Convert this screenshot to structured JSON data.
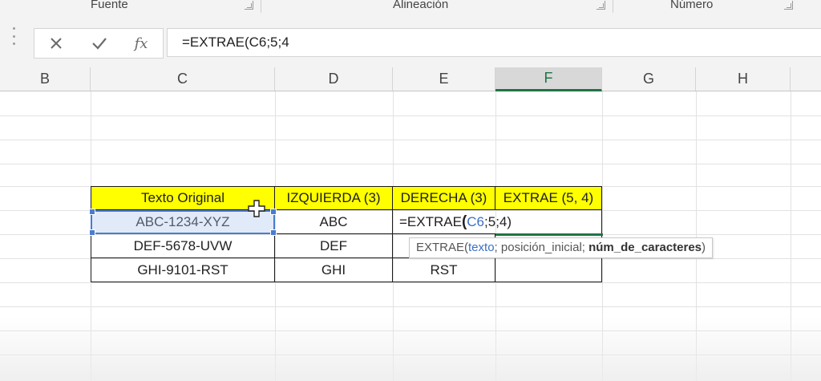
{
  "ribbon": {
    "groups": [
      {
        "label": "Fuente"
      },
      {
        "label": "Alineación"
      },
      {
        "label": "Número"
      }
    ]
  },
  "formula_bar": {
    "cancel_icon": "close-icon",
    "enter_icon": "check-icon",
    "fx_label": "fx",
    "content": "=EXTRAE(C6;5;4"
  },
  "columns": [
    "B",
    "C",
    "D",
    "E",
    "F",
    "G",
    "H"
  ],
  "active_column": "F",
  "table": {
    "headers": [
      "Texto Original",
      "IZQUIERDA (3)",
      "DERECHA (3)",
      "EXTRAE (5, 4)"
    ],
    "rows": [
      [
        "ABC-1234-XYZ",
        "ABC",
        "",
        ""
      ],
      [
        "DEF-5678-UVW",
        "DEF",
        "",
        ""
      ],
      [
        "GHI-9101-RST",
        "GHI",
        "RST",
        ""
      ]
    ]
  },
  "editing_cell": {
    "prefix": "=EXTRAE",
    "paren": "(",
    "ref": "C6",
    "rest": ";5;4)"
  },
  "tooltip": {
    "func": "EXTRAE(",
    "arg1": "texto",
    "sep1": "; posición_inicial; ",
    "arg3": "núm_de_caracteres",
    "close": ")"
  },
  "colors": {
    "header_fill": "#ffff00",
    "accent_green": "#217346",
    "reference_blue": "#3b6fc4"
  }
}
